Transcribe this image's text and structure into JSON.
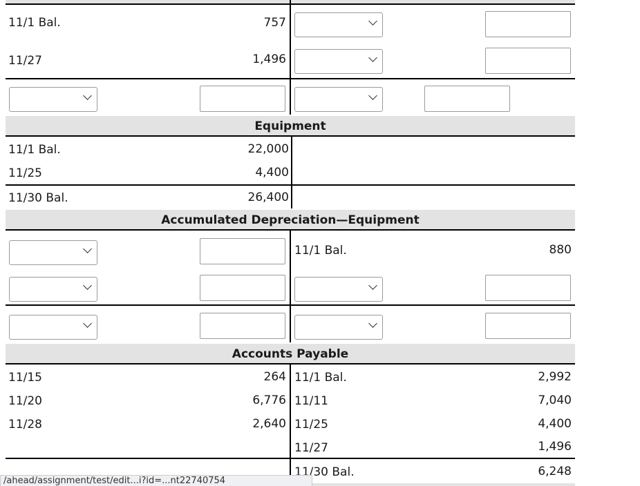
{
  "top_account": {
    "left_rows": [
      {
        "label": "11/1 Bal.",
        "value": "757"
      },
      {
        "label": "11/27",
        "value": "1,496"
      }
    ]
  },
  "equipment": {
    "title": "Equipment",
    "left_rows": [
      {
        "label": "11/1 Bal.",
        "value": "22,000"
      },
      {
        "label": "11/25",
        "value": "4,400"
      }
    ],
    "balance": {
      "label": "11/30 Bal.",
      "value": "26,400"
    }
  },
  "accum_depr": {
    "title": "Accumulated Depreciation—Equipment",
    "right_rows": [
      {
        "label": "11/1 Bal.",
        "value": "880"
      }
    ]
  },
  "accounts_payable": {
    "title": "Accounts Payable",
    "left_rows": [
      {
        "label": "11/15",
        "value": "264"
      },
      {
        "label": "11/20",
        "value": "6,776"
      },
      {
        "label": "11/28",
        "value": "2,640"
      }
    ],
    "right_rows": [
      {
        "label": "11/1 Bal.",
        "value": "2,992"
      },
      {
        "label": "11/11",
        "value": "7,040"
      },
      {
        "label": "11/25",
        "value": "4,400"
      },
      {
        "label": "11/27",
        "value": "1,496"
      }
    ],
    "balance": {
      "label": "11/30 Bal.",
      "value": "6,248"
    }
  },
  "status_bar": {
    "text": "/ahead/assignment/test/edit...i?id=...nt22740754"
  },
  "icons": {
    "dropdown": "chevron-down-icon"
  }
}
